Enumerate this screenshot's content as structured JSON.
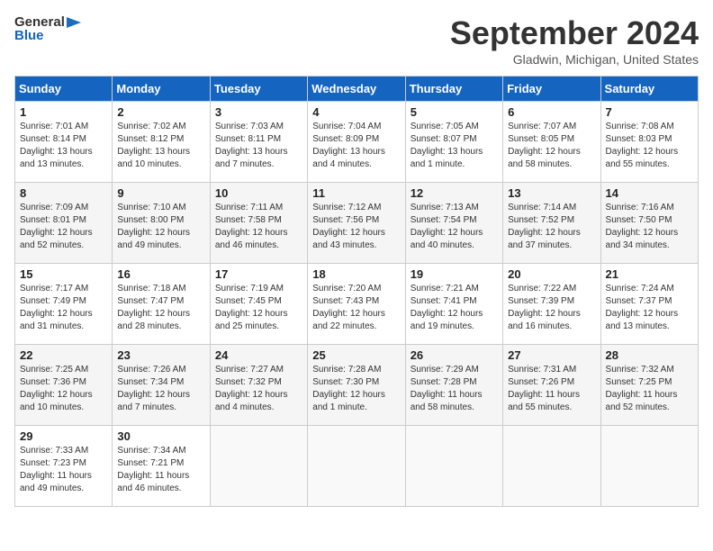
{
  "header": {
    "logo_line1": "General",
    "logo_line2": "Blue",
    "month_title": "September 2024",
    "location": "Gladwin, Michigan, United States"
  },
  "days_of_week": [
    "Sunday",
    "Monday",
    "Tuesday",
    "Wednesday",
    "Thursday",
    "Friday",
    "Saturday"
  ],
  "weeks": [
    [
      {
        "day": "1",
        "lines": [
          "Sunrise: 7:01 AM",
          "Sunset: 8:14 PM",
          "Daylight: 13 hours",
          "and 13 minutes."
        ]
      },
      {
        "day": "2",
        "lines": [
          "Sunrise: 7:02 AM",
          "Sunset: 8:12 PM",
          "Daylight: 13 hours",
          "and 10 minutes."
        ]
      },
      {
        "day": "3",
        "lines": [
          "Sunrise: 7:03 AM",
          "Sunset: 8:11 PM",
          "Daylight: 13 hours",
          "and 7 minutes."
        ]
      },
      {
        "day": "4",
        "lines": [
          "Sunrise: 7:04 AM",
          "Sunset: 8:09 PM",
          "Daylight: 13 hours",
          "and 4 minutes."
        ]
      },
      {
        "day": "5",
        "lines": [
          "Sunrise: 7:05 AM",
          "Sunset: 8:07 PM",
          "Daylight: 13 hours",
          "and 1 minute."
        ]
      },
      {
        "day": "6",
        "lines": [
          "Sunrise: 7:07 AM",
          "Sunset: 8:05 PM",
          "Daylight: 12 hours",
          "and 58 minutes."
        ]
      },
      {
        "day": "7",
        "lines": [
          "Sunrise: 7:08 AM",
          "Sunset: 8:03 PM",
          "Daylight: 12 hours",
          "and 55 minutes."
        ]
      }
    ],
    [
      {
        "day": "8",
        "lines": [
          "Sunrise: 7:09 AM",
          "Sunset: 8:01 PM",
          "Daylight: 12 hours",
          "and 52 minutes."
        ]
      },
      {
        "day": "9",
        "lines": [
          "Sunrise: 7:10 AM",
          "Sunset: 8:00 PM",
          "Daylight: 12 hours",
          "and 49 minutes."
        ]
      },
      {
        "day": "10",
        "lines": [
          "Sunrise: 7:11 AM",
          "Sunset: 7:58 PM",
          "Daylight: 12 hours",
          "and 46 minutes."
        ]
      },
      {
        "day": "11",
        "lines": [
          "Sunrise: 7:12 AM",
          "Sunset: 7:56 PM",
          "Daylight: 12 hours",
          "and 43 minutes."
        ]
      },
      {
        "day": "12",
        "lines": [
          "Sunrise: 7:13 AM",
          "Sunset: 7:54 PM",
          "Daylight: 12 hours",
          "and 40 minutes."
        ]
      },
      {
        "day": "13",
        "lines": [
          "Sunrise: 7:14 AM",
          "Sunset: 7:52 PM",
          "Daylight: 12 hours",
          "and 37 minutes."
        ]
      },
      {
        "day": "14",
        "lines": [
          "Sunrise: 7:16 AM",
          "Sunset: 7:50 PM",
          "Daylight: 12 hours",
          "and 34 minutes."
        ]
      }
    ],
    [
      {
        "day": "15",
        "lines": [
          "Sunrise: 7:17 AM",
          "Sunset: 7:49 PM",
          "Daylight: 12 hours",
          "and 31 minutes."
        ]
      },
      {
        "day": "16",
        "lines": [
          "Sunrise: 7:18 AM",
          "Sunset: 7:47 PM",
          "Daylight: 12 hours",
          "and 28 minutes."
        ]
      },
      {
        "day": "17",
        "lines": [
          "Sunrise: 7:19 AM",
          "Sunset: 7:45 PM",
          "Daylight: 12 hours",
          "and 25 minutes."
        ]
      },
      {
        "day": "18",
        "lines": [
          "Sunrise: 7:20 AM",
          "Sunset: 7:43 PM",
          "Daylight: 12 hours",
          "and 22 minutes."
        ]
      },
      {
        "day": "19",
        "lines": [
          "Sunrise: 7:21 AM",
          "Sunset: 7:41 PM",
          "Daylight: 12 hours",
          "and 19 minutes."
        ]
      },
      {
        "day": "20",
        "lines": [
          "Sunrise: 7:22 AM",
          "Sunset: 7:39 PM",
          "Daylight: 12 hours",
          "and 16 minutes."
        ]
      },
      {
        "day": "21",
        "lines": [
          "Sunrise: 7:24 AM",
          "Sunset: 7:37 PM",
          "Daylight: 12 hours",
          "and 13 minutes."
        ]
      }
    ],
    [
      {
        "day": "22",
        "lines": [
          "Sunrise: 7:25 AM",
          "Sunset: 7:36 PM",
          "Daylight: 12 hours",
          "and 10 minutes."
        ]
      },
      {
        "day": "23",
        "lines": [
          "Sunrise: 7:26 AM",
          "Sunset: 7:34 PM",
          "Daylight: 12 hours",
          "and 7 minutes."
        ]
      },
      {
        "day": "24",
        "lines": [
          "Sunrise: 7:27 AM",
          "Sunset: 7:32 PM",
          "Daylight: 12 hours",
          "and 4 minutes."
        ]
      },
      {
        "day": "25",
        "lines": [
          "Sunrise: 7:28 AM",
          "Sunset: 7:30 PM",
          "Daylight: 12 hours",
          "and 1 minute."
        ]
      },
      {
        "day": "26",
        "lines": [
          "Sunrise: 7:29 AM",
          "Sunset: 7:28 PM",
          "Daylight: 11 hours",
          "and 58 minutes."
        ]
      },
      {
        "day": "27",
        "lines": [
          "Sunrise: 7:31 AM",
          "Sunset: 7:26 PM",
          "Daylight: 11 hours",
          "and 55 minutes."
        ]
      },
      {
        "day": "28",
        "lines": [
          "Sunrise: 7:32 AM",
          "Sunset: 7:25 PM",
          "Daylight: 11 hours",
          "and 52 minutes."
        ]
      }
    ],
    [
      {
        "day": "29",
        "lines": [
          "Sunrise: 7:33 AM",
          "Sunset: 7:23 PM",
          "Daylight: 11 hours",
          "and 49 minutes."
        ]
      },
      {
        "day": "30",
        "lines": [
          "Sunrise: 7:34 AM",
          "Sunset: 7:21 PM",
          "Daylight: 11 hours",
          "and 46 minutes."
        ]
      },
      {
        "day": "",
        "lines": []
      },
      {
        "day": "",
        "lines": []
      },
      {
        "day": "",
        "lines": []
      },
      {
        "day": "",
        "lines": []
      },
      {
        "day": "",
        "lines": []
      }
    ]
  ]
}
